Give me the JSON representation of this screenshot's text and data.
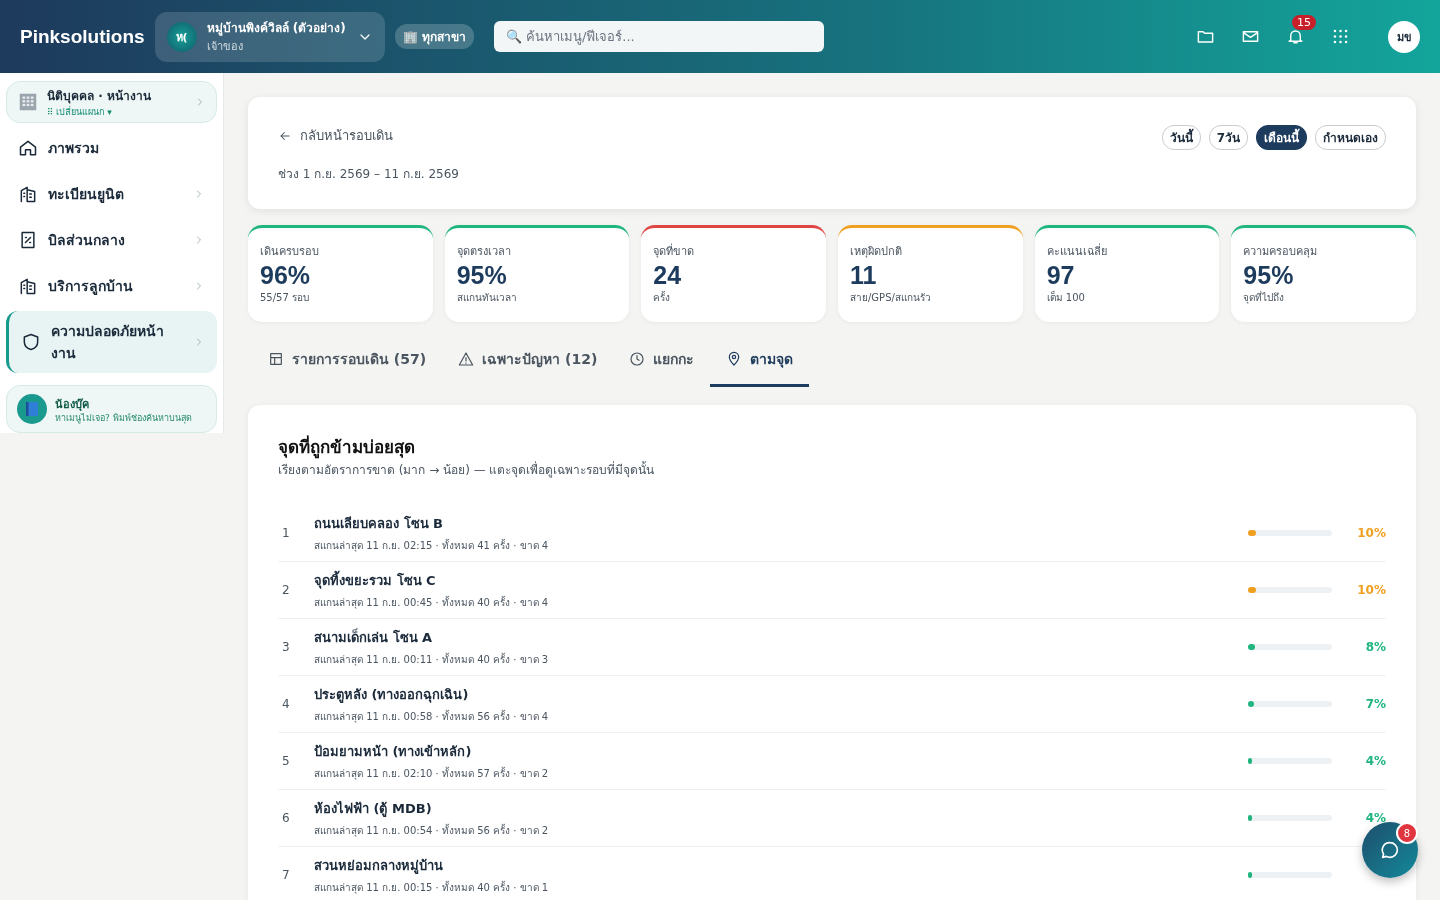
{
  "brand": "Pinksolutions",
  "org": {
    "initials": "ห(",
    "name": "หมู่บ้านพิงค์วิลล์ (ตัวอย่าง)",
    "role": "เจ้าของ"
  },
  "branch": "🏢 ทุกสาขา",
  "search": {
    "placeholder": "🔍 ค้นหาเมนู/ฟีเจอร์..."
  },
  "notifications": "15",
  "avatar": "มข",
  "sidebar": {
    "department": {
      "name": "นิติบุคคล · หน้างาน",
      "switch": "⠿ เปลี่ยนแผนก ▾"
    },
    "items": [
      {
        "label": "ภาพรวม",
        "kind": "home",
        "has_children": false,
        "selected": false
      },
      {
        "label": "ทะเบียนยูนิต",
        "kind": "building",
        "has_children": true,
        "selected": false
      },
      {
        "label": "บิลส่วนกลาง",
        "kind": "receipt",
        "has_children": true,
        "selected": false
      },
      {
        "label": "บริการลูกบ้าน",
        "kind": "building",
        "has_children": true,
        "selected": false
      },
      {
        "label": "ความปลอดภัยหน้างาน",
        "kind": "shield",
        "has_children": true,
        "selected": true
      }
    ],
    "helper": {
      "name": "น้องบุ๊ค",
      "hint": "หาเมนูไม่เจอ? พิมพ์ช่องค้นหาบนสุด"
    }
  },
  "header": {
    "back": "กลับหน้ารอบเดิน",
    "range": "ช่วง 1 ก.ย. 2569 – 11 ก.ย. 2569",
    "periods": [
      {
        "label": "วันนี้",
        "selected": false
      },
      {
        "label": "7วัน",
        "selected": false
      },
      {
        "label": "เดือนนี้",
        "selected": true
      },
      {
        "label": "กำหนดเอง",
        "selected": false
      }
    ]
  },
  "stats": [
    {
      "label": "เดินครบรอบ",
      "value": "96%",
      "sub": "55/57 รอบ",
      "color": "#1fb57f"
    },
    {
      "label": "จุดตรงเวลา",
      "value": "95%",
      "sub": "สแกนทันเวลา",
      "color": "#1fb57f"
    },
    {
      "label": "จุดที่ขาด",
      "value": "24",
      "sub": "ครั้ง",
      "color": "#e04545"
    },
    {
      "label": "เหตุผิดปกติ",
      "value": "11",
      "sub": "สาย/GPS/สแกนรัว",
      "color": "#f0a020"
    },
    {
      "label": "คะแนนเฉลี่ย",
      "value": "97",
      "sub": "เต็ม 100",
      "color": "#1fb57f"
    },
    {
      "label": "ความครอบคลุม",
      "value": "95%",
      "sub": "จุดที่ไปถึง",
      "color": "#1fb57f"
    }
  ],
  "tabs": [
    {
      "label": "รายการรอบเดิน (57)",
      "kind": "table",
      "selected": false
    },
    {
      "label": "เฉพาะปัญหา (12)",
      "kind": "warning",
      "selected": false
    },
    {
      "label": "แยกกะ",
      "kind": "clock",
      "selected": false
    },
    {
      "label": "ตามจุด",
      "kind": "pin",
      "selected": true
    }
  ],
  "panel": {
    "title": "จุดที่ถูกข้ามบ่อยสุด",
    "subtitle": "เรียงตามอัตราการขาด (มาก → น้อย) — แตะจุดเพื่อดูเฉพาะรอบที่มีจุดนั้น",
    "rows": [
      {
        "rank": "1",
        "name": "ถนนเลียบคลอง โซน B",
        "detail": "สแกนล่าสุด 11 ก.ย. 02:15 · ทั้งหมด 41 ครั้ง · ขาด 4",
        "level": 0.1,
        "percent": "10%",
        "color": "#f0a020"
      },
      {
        "rank": "2",
        "name": "จุดทิ้งขยะรวม โซน C",
        "detail": "สแกนล่าสุด 11 ก.ย. 00:45 · ทั้งหมด 40 ครั้ง · ขาด 4",
        "level": 0.1,
        "percent": "10%",
        "color": "#f0a020"
      },
      {
        "rank": "3",
        "name": "สนามเด็กเล่น โซน A",
        "detail": "สแกนล่าสุด 11 ก.ย. 00:11 · ทั้งหมด 40 ครั้ง · ขาด 3",
        "level": 0.08,
        "percent": "8%",
        "color": "#1fb57f"
      },
      {
        "rank": "4",
        "name": "ประตูหลัง (ทางออกฉุกเฉิน)",
        "detail": "สแกนล่าสุด 11 ก.ย. 00:58 · ทั้งหมด 56 ครั้ง · ขาด 4",
        "level": 0.07,
        "percent": "7%",
        "color": "#1fb57f"
      },
      {
        "rank": "5",
        "name": "ป้อมยามหน้า (ทางเข้าหลัก)",
        "detail": "สแกนล่าสุด 11 ก.ย. 02:10 · ทั้งหมด 57 ครั้ง · ขาด 2",
        "level": 0.04,
        "percent": "4%",
        "color": "#1fb57f"
      },
      {
        "rank": "6",
        "name": "ห้องไฟฟ้า (ตู้ MDB)",
        "detail": "สแกนล่าสุด 11 ก.ย. 00:54 · ทั้งหมด 56 ครั้ง · ขาด 2",
        "level": 0.04,
        "percent": "4%",
        "color": "#1fb57f"
      },
      {
        "rank": "7",
        "name": "สวนหย่อมกลางหมู่บ้าน",
        "detail": "สแกนล่าสุด 11 ก.ย. 00:15 · ทั้งหมด 40 ครั้ง · ขาด 1",
        "level": 0.03,
        "color": "#1fb57f"
      }
    ]
  },
  "chat_badge": "8"
}
